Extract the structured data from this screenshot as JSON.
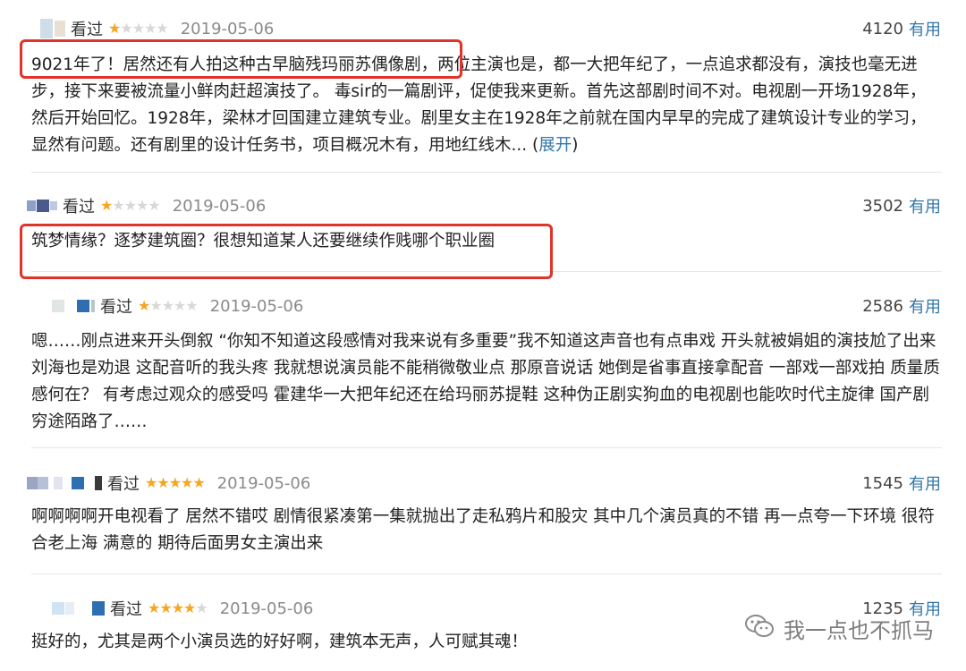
{
  "reviews": [
    {
      "status": "看过",
      "rating": 1,
      "date": "2019-05-06",
      "votes": "4120",
      "useful": "有用",
      "text": "9021年了！居然还有人拍这种古早脑残玛丽苏偶像剧，两位主演也是，都一大把年纪了，一点追求都没有，演技也毫无进步，接下来要被流量小鲜肉赶超演技了。 毒sir的一篇剧评，促使我来更新。首先这部剧时间不对。电视剧一开场1928年，然后开始回忆。1928年，梁林才回国建立建筑专业。剧里女主在1928年之前就在国内早早的完成了建筑设计专业的学习，显然有问题。还有剧里的设计任务书，项目概况木有，用地红线木... (",
      "expand": "展开",
      "expand_close": ")"
    },
    {
      "status": "看过",
      "rating": 1,
      "date": "2019-05-06",
      "votes": "3502",
      "useful": "有用",
      "text": "筑梦情缘？逐梦建筑圈？很想知道某人还要继续作贱哪个职业圈"
    },
    {
      "status": "看过",
      "rating": 1,
      "date": "2019-05-06",
      "votes": "2586",
      "useful": "有用",
      "text": "嗯……刚点进来开头倒叙 “你知不知道这段感情对我来说有多重要”我不知道这声音也有点串戏 开头就被娟姐的演技尬了出来 刘海也是劝退 这配音听的我头疼 我就想说演员能不能稍微敬业点 那原音说话 她倒是省事直接拿配音 一部戏一部戏拍 质量质感何在？ 有考虑过观众的感受吗 霍建华一大把年纪还在给玛丽苏提鞋 这种伪正剧实狗血的电视剧也能吹时代主旋律 国产剧穷途陌路了……"
    },
    {
      "status": "看过",
      "rating": 5,
      "date": "2019-05-06",
      "votes": "1545",
      "useful": "有用",
      "text": "啊啊啊啊开电视看了 居然不错哎 剧情很紧凑第一集就抛出了走私鸦片和股灾 其中几个演员真的不错 再一点夸一下环境 很符合老上海 满意的 期待后面男女主演出来"
    },
    {
      "status": "看过",
      "rating": 4,
      "date": "2019-05-06",
      "votes": "1235",
      "useful": "有用",
      "text": "挺好的，尤其是两个小演员选的好好啊，建筑本无声，人可赋其魂！"
    }
  ],
  "watermark": {
    "text": "我一点也不抓马",
    "icon": "wechat-icon"
  },
  "colors": {
    "star_on": "#f5a623",
    "star_off": "#d8d8d8",
    "link": "#3377aa",
    "highlight": "#e0332a"
  },
  "star_glyph": "★"
}
